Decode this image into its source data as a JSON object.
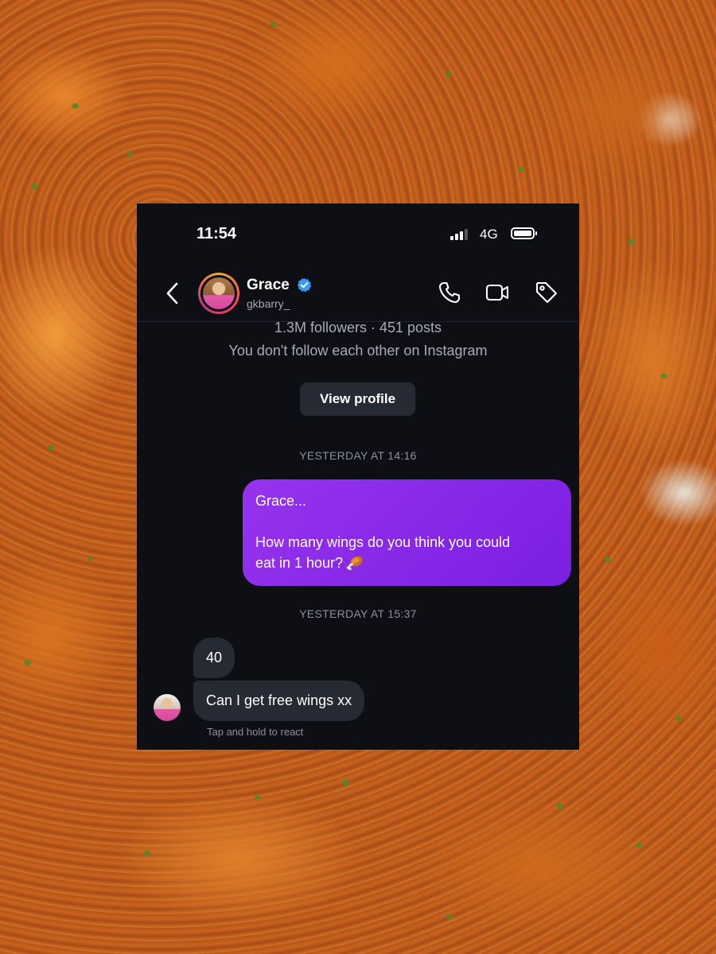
{
  "status_bar": {
    "time": "11:54",
    "network": "4G"
  },
  "header": {
    "name": "Grace",
    "username": "gkbarry_"
  },
  "profile": {
    "stats": "1.3M followers · 451 posts",
    "relation": "You don't follow each other on Instagram",
    "view_profile_label": "View profile"
  },
  "messages": {
    "timestamp_1": "YESTERDAY AT 14:16",
    "sent_line_1": "Grace...",
    "sent_line_2a": "How many wings do you think you could",
    "sent_line_2b": "eat in 1 hour?",
    "timestamp_2": "YESTERDAY AT 15:37",
    "reply_1": "40",
    "reply_2": "Can I get free wings xx",
    "hint": "Tap and hold to react"
  },
  "colors": {
    "screen_bg": "#0d0f14",
    "sent_bubble": "#8a2be2",
    "received_bubble": "#262a33",
    "verified_badge": "#3897f0"
  },
  "icons": [
    "back-chevron-icon",
    "verified-badge-icon",
    "phone-call-icon",
    "video-call-icon",
    "tag-icon",
    "drumstick-emoji-icon"
  ]
}
